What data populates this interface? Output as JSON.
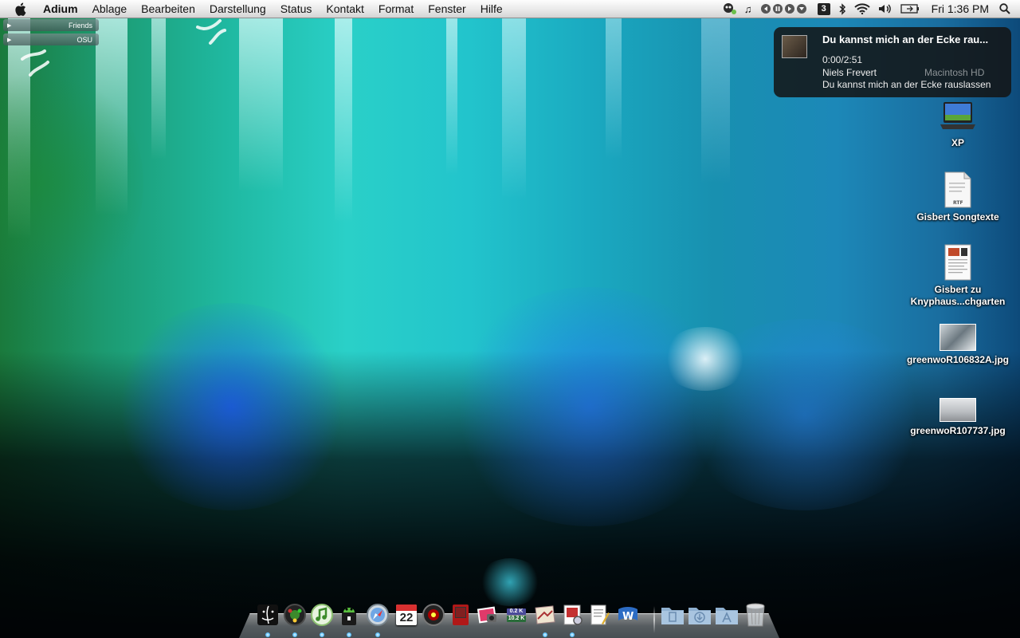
{
  "menubar": {
    "app_name": "Adium",
    "menus": [
      "Ablage",
      "Bearbeiten",
      "Darstellung",
      "Status",
      "Kontakt",
      "Format",
      "Fenster",
      "Hilfe"
    ],
    "clock": "Fri 1:36 PM",
    "status_icons": [
      "adium-duck-icon",
      "itunes-note-icon",
      "playback-controls-icon",
      "spaces-icon",
      "bluetooth-icon",
      "wifi-icon",
      "volume-icon",
      "battery-icon",
      "spotlight-icon"
    ],
    "spaces_number": "3"
  },
  "buddy_list": {
    "groups": [
      {
        "name": "Friends"
      },
      {
        "name": "OSU"
      }
    ]
  },
  "notification": {
    "title": "Du kannst mich an der Ecke rau...",
    "time": "0:00/2:51",
    "artist": "Niels Frevert",
    "track": "Du kannst mich an der Ecke rauslassen"
  },
  "desktop_icons": [
    {
      "label": "Macintosh HD",
      "type": "hard-drive"
    },
    {
      "label": "XP",
      "type": "laptop"
    },
    {
      "label": "Gisbert Songtexte",
      "type": "rtf-document"
    },
    {
      "label": "Gisbert zu Knyphaus...chgarten",
      "type": "document"
    },
    {
      "label": "greenwoR106832A.jpg",
      "type": "image"
    },
    {
      "label": "greenwoR107737.jpg",
      "type": "image"
    }
  ],
  "dock": {
    "calendar_day": "22",
    "netmon_up": "0.2 K",
    "netmon_down": "10.2 K",
    "items": [
      "finder",
      "adium",
      "itunes",
      "cyberduck",
      "safari",
      "ical",
      "istat",
      "photo-booth",
      "iphoto",
      "netmon",
      "mail",
      "textedit",
      "preview",
      "pages",
      "word",
      "documents-stack",
      "downloads-stack",
      "applications-stack",
      "trash"
    ]
  },
  "colors": {
    "menubar_bg": "#e9e9e9",
    "notification_bg": "#141414",
    "running_indicator": "#58c0ff"
  }
}
